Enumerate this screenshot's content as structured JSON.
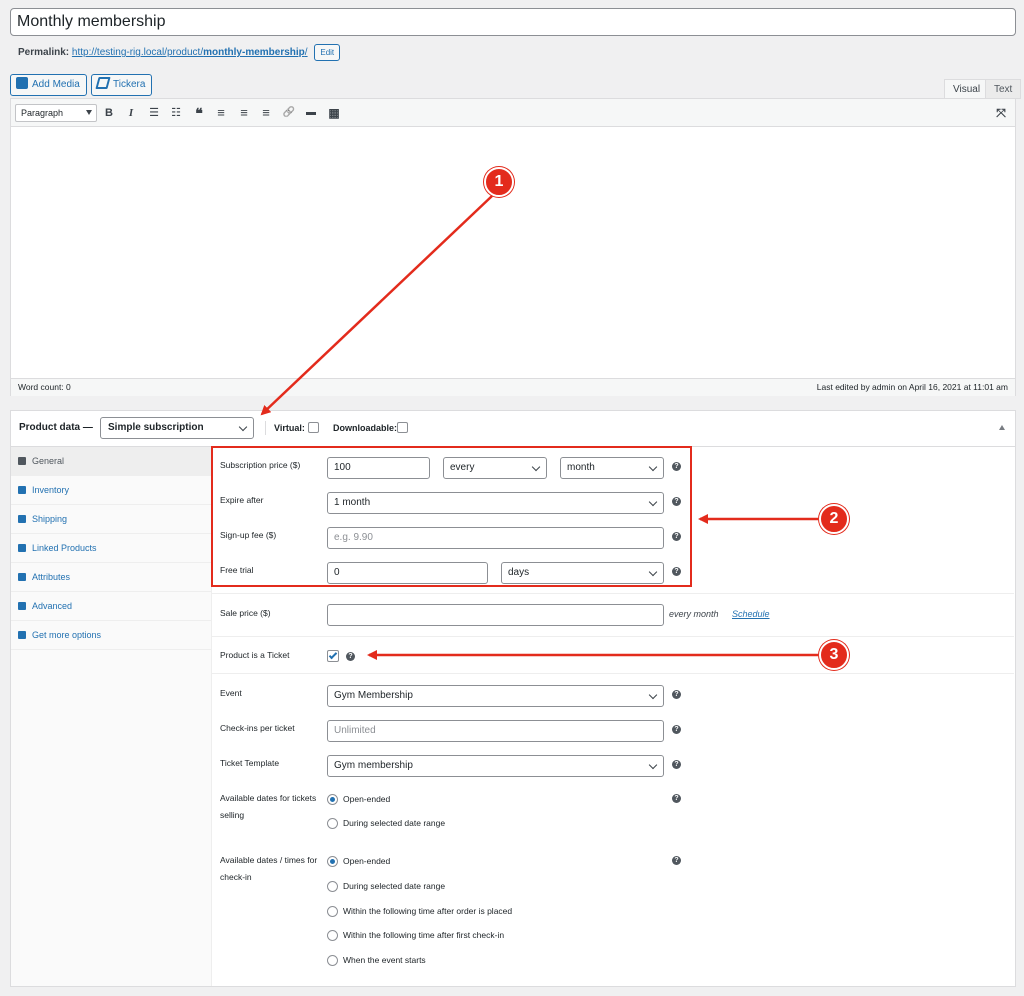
{
  "post": {
    "title": "Monthly membership",
    "permalink_label": "Permalink:",
    "permalink_base": "http://testing-rig.local/product/",
    "permalink_slug": "monthly-membership",
    "permalink_trail": "/",
    "edit_label": "Edit"
  },
  "media_buttons": {
    "add_media": "Add Media",
    "tickera": "Tickera"
  },
  "editor_tabs": {
    "visual": "Visual",
    "text": "Text"
  },
  "toolbar": {
    "format": "Paragraph",
    "icons": [
      "bold-icon",
      "italic-icon",
      "bullet-list-icon",
      "numbered-list-icon",
      "blockquote-icon",
      "align-left-icon",
      "align-center-icon",
      "align-right-icon",
      "link-icon",
      "read-more-icon",
      "toolbar-toggle-icon"
    ],
    "glyphs": {
      "bold": "B",
      "italic": "I",
      "bullet": "☰",
      "number": "☷",
      "quote": "❝",
      "left": "≡",
      "center": "≡",
      "right": "≡",
      "link": "🔗",
      "more": "▬",
      "kitchen": "▦",
      "fullscreen": "⤧"
    }
  },
  "status_bar": {
    "word_count": "Word count: 0",
    "last_edited": "Last edited by admin on April 16, 2021 at 11:01 am"
  },
  "product_data": {
    "label": "Product data —",
    "type": "Simple subscription",
    "virtual_label": "Virtual:",
    "downloadable_label": "Downloadable:",
    "tabs": [
      "General",
      "Inventory",
      "Shipping",
      "Linked Products",
      "Attributes",
      "Advanced",
      "Get more options"
    ]
  },
  "fields": {
    "subscription_price_label": "Subscription price ($)",
    "subscription_price": "100",
    "billing_interval": "every",
    "billing_period": "month",
    "expire_label": "Expire after",
    "expire_value": "1 month",
    "signup_label": "Sign-up fee ($)",
    "signup_placeholder": "e.g. 9.90",
    "trial_label": "Free trial",
    "trial_value": "0",
    "trial_period": "days",
    "sale_label": "Sale price ($)",
    "sale_suffix": "every month",
    "schedule_link": "Schedule",
    "ticket_label": "Product is a Ticket",
    "event_label": "Event",
    "event_value": "Gym Membership",
    "checkins_label": "Check-ins per ticket",
    "checkins_placeholder": "Unlimited",
    "template_label": "Ticket Template",
    "template_value": "Gym membership",
    "selling_label_1": "Available dates for tickets",
    "selling_label_2": "selling",
    "selling_options": [
      "Open-ended",
      "During selected date range"
    ],
    "checkin_label_1": "Available dates / times for",
    "checkin_label_2": "check-in",
    "checkin_options": [
      "Open-ended",
      "During selected date range",
      "Within the following time after order is placed",
      "Within the following time after first check-in",
      "When the event starts"
    ],
    "help_glyph": "?"
  },
  "annotations": {
    "one": "1",
    "two": "2",
    "three": "3",
    "color": "#e32b1c"
  },
  "colors": {
    "accent": "#2271b1",
    "annotation": "#e32b1c",
    "background": "#f0f0f1"
  }
}
